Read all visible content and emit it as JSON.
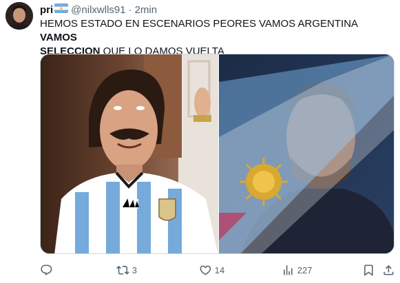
{
  "tweet": {
    "display_name": "pri",
    "flag_emoji_name": "argentina-flag",
    "handle": "@nilxwlls91",
    "separator": "·",
    "time": "2min",
    "text_part1": "HEMOS ESTADO EN ESCENARIOS PEORES VAMOS ARGENTINA ",
    "text_bold1": "VAMOS",
    "text_bold2": "SELECCION",
    "text_part2": " QUE LO DAMOS VUELTA"
  },
  "media": {
    "left_image": "man-in-argentina-jersey-looking-up",
    "right_image": "player-with-argentina-flag"
  },
  "actions": {
    "reply": {
      "icon": "reply-icon",
      "count": ""
    },
    "retweet": {
      "icon": "retweet-icon",
      "count": "3"
    },
    "like": {
      "icon": "heart-icon",
      "count": "14"
    },
    "views": {
      "icon": "views-icon",
      "count": "227"
    },
    "bookmark": {
      "icon": "bookmark-icon"
    },
    "share": {
      "icon": "share-icon"
    }
  },
  "colors": {
    "text_primary": "#0f1419",
    "text_secondary": "#536471",
    "argentina_blue": "#75aadb"
  }
}
